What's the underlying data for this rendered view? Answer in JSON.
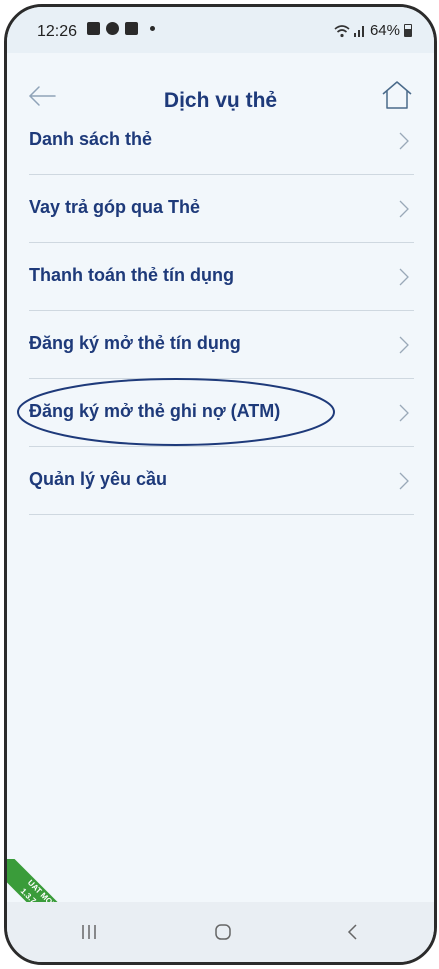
{
  "status": {
    "time": "12:26",
    "battery": "64%",
    "icons": [
      "gallery-icon",
      "settings-gear-icon",
      "app-icon",
      "dot-icon",
      "wifi-icon",
      "signal-icon",
      "battery-icon"
    ]
  },
  "header": {
    "title": "Dịch vụ thẻ",
    "back_icon": "arrow-left-icon",
    "home_icon": "home-icon"
  },
  "menu": {
    "items": [
      {
        "label": "Danh sách thẻ"
      },
      {
        "label": "Vay trả góp qua Thẻ"
      },
      {
        "label": "Thanh toán thẻ tín dụng"
      },
      {
        "label": "Đăng ký mở thẻ tín dụng"
      },
      {
        "label": "Đăng ký mở thẻ ghi nợ (ATM)",
        "highlighted": true
      },
      {
        "label": "Quản lý yêu cầu"
      }
    ]
  },
  "badge": {
    "line1": "UAT MODE",
    "line2": "1.3.7.2.123"
  },
  "navbar": {
    "buttons": [
      "recents-icon",
      "home-circle-icon",
      "back-chevron-icon"
    ]
  },
  "colors": {
    "accent": "#1e3a7a",
    "background": "#f2f7fb",
    "divider": "#cfd8e0",
    "badge": "#3a9c3a"
  }
}
